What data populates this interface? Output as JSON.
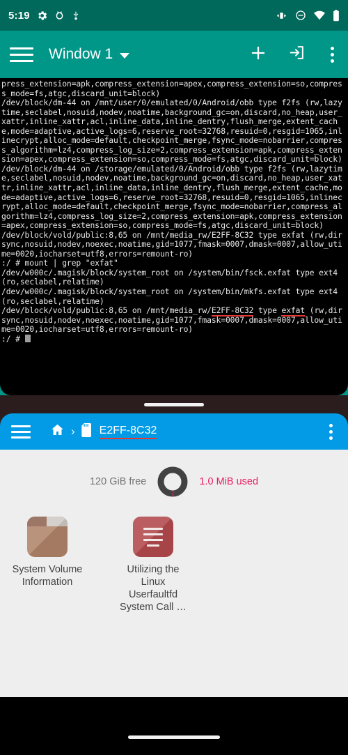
{
  "status_bar": {
    "time": "5:19",
    "left_icons": [
      "settings-gear-icon",
      "android-debug-icon",
      "usb-icon"
    ],
    "right_icons": [
      "vibrate-icon",
      "do-not-disturb-icon",
      "wifi-icon",
      "battery-icon"
    ],
    "background_color": "#00695C"
  },
  "terminal": {
    "toolbar": {
      "menu_label": "hamburger-menu",
      "title": "Window 1",
      "dropdown_icon": "chevron-down-icon",
      "new_window_label": "+",
      "input_icon": "input-arrow-icon",
      "overflow_label": "more-options",
      "background_color": "#009688"
    },
    "lines": [
      "press_extension=apk,compress_extension=apex,compress_extension=so,compress_mode=fs,atgc,discard_unit=block)",
      "/dev/block/dm-44 on /mnt/user/0/emulated/0/Android/obb type f2fs (rw,lazytime,seclabel,nosuid,nodev,noatime,background_gc=on,discard,no_heap,user_xattr,inline_xattr,acl,inline_data,inline_dentry,flush_merge,extent_cache,mode=adaptive,active_logs=6,reserve_root=32768,resuid=0,resgid=1065,inlinecrypt,alloc_mode=default,checkpoint_merge,fsync_mode=nobarrier,compress_algorithm=lz4,compress_log_size=2,compress_extension=apk,compress_extension=apex,compress_extension=so,compress_mode=fs,atgc,discard_unit=block)",
      "/dev/block/dm-44 on /storage/emulated/0/Android/obb type f2fs (rw,lazytime,seclabel,nosuid,nodev,noatime,background_gc=on,discard,no_heap,user_xattr,inline_xattr,acl,inline_data,inline_dentry,flush_merge,extent_cache,mode=adaptive,active_logs=6,reserve_root=32768,resuid=0,resgid=1065,inlinecrypt,alloc_mode=default,checkpoint_merge,fsync_mode=nobarrier,compress_algorithm=lz4,compress_log_size=2,compress_extension=apk,compress_extension=apex,compress_extension=so,compress_mode=fs,atgc,discard_unit=block)",
      "/dev/block/vold/public:8,65 on /mnt/media_rw/E2FF-8C32 type exfat (rw,dirsync,nosuid,nodev,noexec,noatime,gid=1077,fmask=0007,dmask=0007,allow_utime=0020,iocharset=utf8,errors=remount-ro)",
      ":/ # mount | grep \"exfat\"",
      "/dev/w000c/.magisk/block/system_root on /system/bin/fsck.exfat type ext4 (ro,seclabel,relatime)",
      "/dev/w000c/.magisk/block/system_root on /system/bin/mkfs.exfat type ext4 (ro,seclabel,relatime)"
    ],
    "highlighted_line": {
      "prefix": "/dev/block/vold/public:8,65 on /mnt/media_rw/",
      "highlight_1": "E2FF-8C32",
      "middle": " type ",
      "highlight_2": "exfat",
      "suffix": " (rw,dirsync,nosuid,nodev,noexec,noatime,gid=1077,fmask=0007,dmask=0007,allow_utime=0020,iocharset=utf8,errors=remount-ro)"
    },
    "prompt": ":/ # ",
    "highlight_color": "#e53935"
  },
  "divider": {
    "handle_name": "split-screen-drag-handle"
  },
  "file_manager": {
    "toolbar": {
      "menu_label": "hamburger-menu",
      "home_icon": "home-icon",
      "separator": "›",
      "sdcard_icon": "sdcard-icon",
      "current_path": "E2FF-8C32",
      "overflow_label": "more-options",
      "background_color": "#039BE5",
      "underline_color": "#e53935"
    },
    "storage": {
      "free_text": "120 GiB free",
      "used_text": "1.0 MiB used",
      "free_color": "#757575",
      "used_color": "#e91e63",
      "ring_color": "#424242",
      "used_percent": 1
    },
    "items": [
      {
        "name": "System Volume Information",
        "icon": "folder-icon",
        "type": "folder"
      },
      {
        "name": "Utilizing the Linux Userfaultfd System Call …",
        "icon": "document-icon",
        "type": "file"
      }
    ]
  },
  "nav_bar": {
    "handle_name": "gesture-pill"
  }
}
